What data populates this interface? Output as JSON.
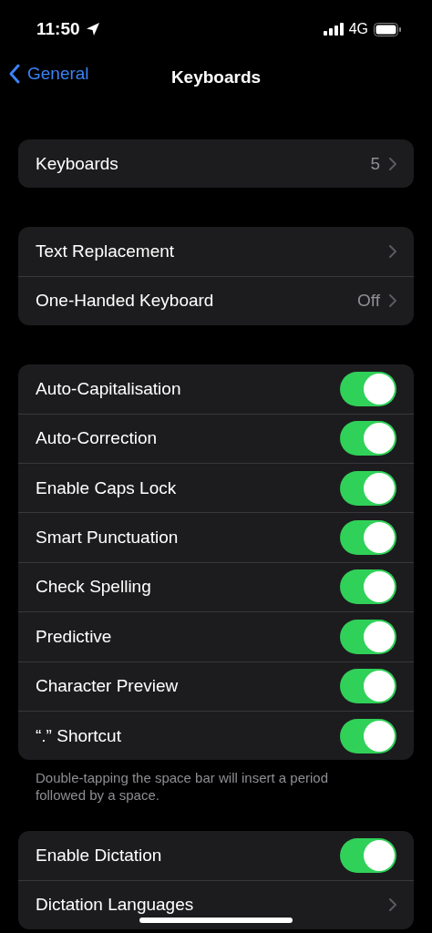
{
  "status_bar": {
    "time": "11:50",
    "network": "4G"
  },
  "nav": {
    "back": "General",
    "title": "Keyboards"
  },
  "groups": [
    {
      "rows": [
        {
          "kind": "link",
          "label": "Keyboards",
          "value": "5"
        }
      ]
    },
    {
      "rows": [
        {
          "kind": "link",
          "label": "Text Replacement"
        },
        {
          "kind": "link",
          "label": "One-Handed Keyboard",
          "value": "Off"
        }
      ]
    },
    {
      "rows": [
        {
          "kind": "toggle",
          "label": "Auto-Capitalisation",
          "on": true
        },
        {
          "kind": "toggle",
          "label": "Auto-Correction",
          "on": true
        },
        {
          "kind": "toggle",
          "label": "Enable Caps Lock",
          "on": true
        },
        {
          "kind": "toggle",
          "label": "Smart Punctuation",
          "on": true
        },
        {
          "kind": "toggle",
          "label": "Check Spelling",
          "on": true
        },
        {
          "kind": "toggle",
          "label": "Predictive",
          "on": true
        },
        {
          "kind": "toggle",
          "label": "Character Preview",
          "on": true
        },
        {
          "kind": "toggle",
          "label": "“.” Shortcut",
          "on": true
        }
      ],
      "footer": "Double-tapping the space bar will insert a period followed by a space."
    },
    {
      "rows": [
        {
          "kind": "toggle",
          "label": "Enable Dictation",
          "on": true
        },
        {
          "kind": "link",
          "label": "Dictation Languages"
        }
      ]
    }
  ]
}
